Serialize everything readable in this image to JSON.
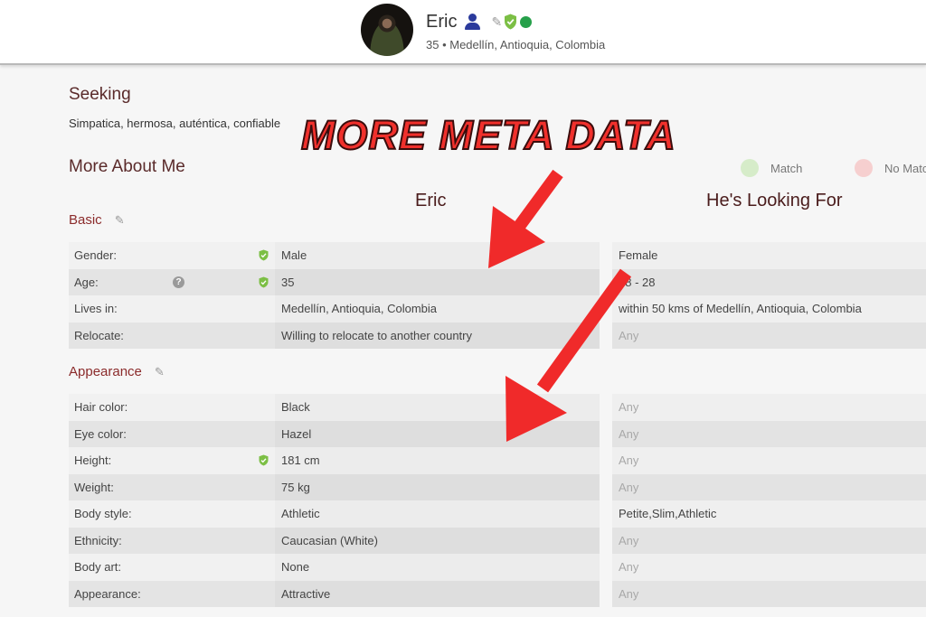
{
  "header": {
    "name": "Eric",
    "subline": "35 • Medellín, Antioquia, Colombia",
    "icons": [
      "user-icon",
      "pencil-icon",
      "verified-shield-icon",
      "online-status-dot"
    ]
  },
  "seeking": {
    "title": "Seeking",
    "text": "Simpatica, hermosa, auténtica, confiable"
  },
  "more_about": {
    "title": "More About Me",
    "legend": [
      {
        "label": "Match",
        "color": "#d6ecc9"
      },
      {
        "label": "No Match",
        "color": "#f6cfcf"
      }
    ],
    "col_self": "Eric",
    "col_looking": "He's Looking For"
  },
  "overlay": {
    "caption": "MORE META DATA",
    "arrow_color": "#f02a2a"
  },
  "sections": [
    {
      "title": "Basic",
      "rows": [
        {
          "label": "Gender:",
          "value": "Male",
          "looking": "Female",
          "verified": true,
          "help": false,
          "looking_any": false
        },
        {
          "label": "Age:",
          "value": "35",
          "looking": "18 - 28",
          "verified": true,
          "help": true,
          "looking_any": false
        },
        {
          "label": "Lives in:",
          "value": "Medellín, Antioquia, Colombia",
          "looking": "within 50 kms of Medellín, Antioquia, Colombia",
          "verified": false,
          "help": false,
          "looking_any": false
        },
        {
          "label": "Relocate:",
          "value": "Willing to relocate to another country",
          "looking": "Any",
          "verified": false,
          "help": false,
          "looking_any": true
        }
      ]
    },
    {
      "title": "Appearance",
      "rows": [
        {
          "label": "Hair color:",
          "value": "Black",
          "looking": "Any",
          "verified": false,
          "help": false,
          "looking_any": true
        },
        {
          "label": "Eye color:",
          "value": "Hazel",
          "looking": "Any",
          "verified": false,
          "help": false,
          "looking_any": true
        },
        {
          "label": "Height:",
          "value": "181 cm",
          "looking": "Any",
          "verified": true,
          "help": false,
          "looking_any": true
        },
        {
          "label": "Weight:",
          "value": "75 kg",
          "looking": "Any",
          "verified": false,
          "help": false,
          "looking_any": true
        },
        {
          "label": "Body style:",
          "value": "Athletic",
          "looking": "Petite,Slim,Athletic",
          "verified": false,
          "help": false,
          "looking_any": false
        },
        {
          "label": "Ethnicity:",
          "value": "Caucasian (White)",
          "looking": "Any",
          "verified": false,
          "help": false,
          "looking_any": true
        },
        {
          "label": "Body art:",
          "value": "None",
          "looking": "Any",
          "verified": false,
          "help": false,
          "looking_any": true
        },
        {
          "label": "Appearance:",
          "value": "Attractive",
          "looking": "Any",
          "verified": false,
          "help": false,
          "looking_any": true
        }
      ]
    }
  ]
}
